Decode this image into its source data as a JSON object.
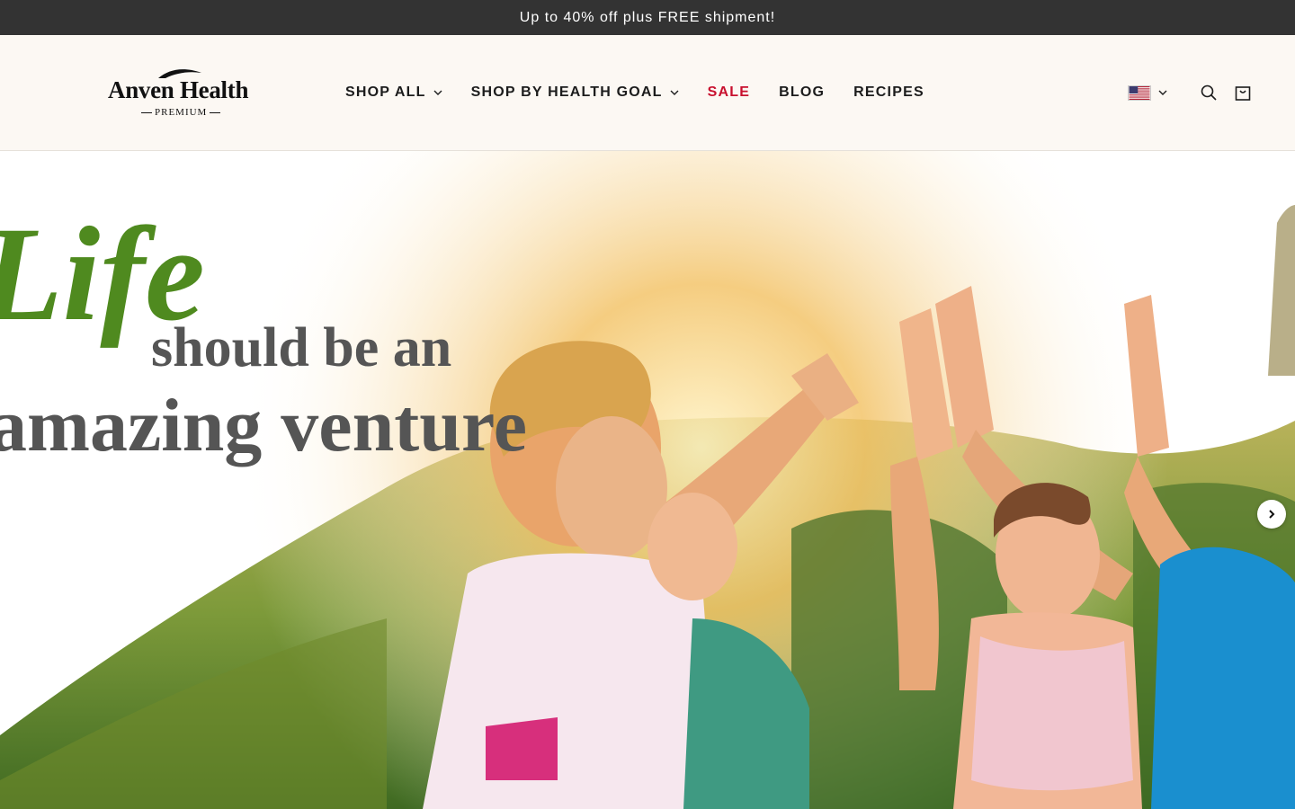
{
  "announcement": {
    "text": "Up to 40% off plus FREE shipment!"
  },
  "brand": {
    "name": "Anven Health",
    "tagline": "PREMIUM"
  },
  "nav": {
    "items": [
      {
        "label": "SHOP ALL",
        "has_dropdown": true
      },
      {
        "label": "SHOP BY HEALTH GOAL",
        "has_dropdown": true
      },
      {
        "label": "SALE",
        "has_dropdown": false,
        "color": "#c8102e"
      },
      {
        "label": "BLOG",
        "has_dropdown": false
      },
      {
        "label": "RECIPES",
        "has_dropdown": false
      }
    ]
  },
  "header_tools": {
    "country_selector": {
      "icon": "us-flag-icon"
    },
    "search": {
      "icon": "search-icon"
    },
    "cart": {
      "icon": "cart-icon"
    }
  },
  "hero": {
    "headline_word": "Life",
    "headline_line1": "should be an",
    "headline_line2": "amazing venture",
    "next_control": {
      "icon": "chevron-right-icon"
    }
  },
  "colors": {
    "announcement_bg": "#333333",
    "header_bg": "#fcf8f3",
    "accent_green": "#4f8a1f",
    "sale_red": "#c8102e",
    "headline_gray": "#555555"
  }
}
